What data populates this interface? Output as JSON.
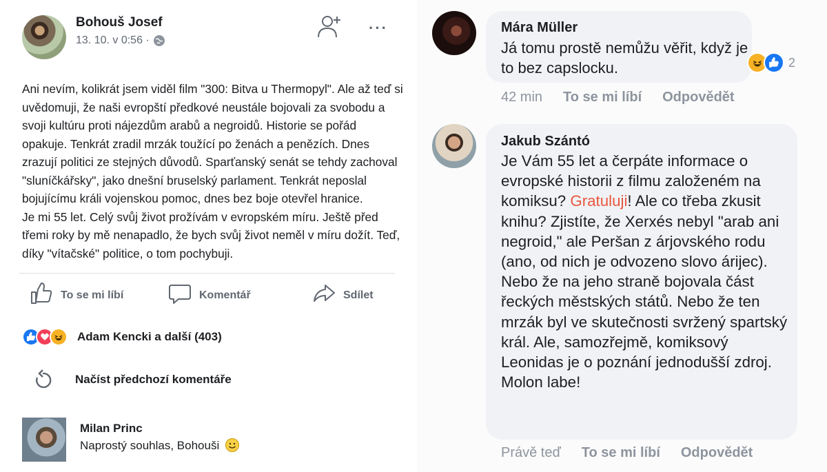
{
  "post": {
    "author": "Bohouš Josef",
    "timestamp": "13. 10. v 0:56 ·",
    "body": "Ani nevím, kolikrát jsem viděl film \"300: Bitva u Thermopyl\". Ale až teď si uvědomuji, že naši evropští předkové neustále bojovali za svobodu a svoji kultúru proti nájezdům arabů a negroidů. Historie se pořád opakuje. Tenkrát zradil mrzák toužící po ženách a penězích. Dnes zrazují politici ze stejných důvodů. Sparťanský senát se tehdy zachoval \"sluníčkářsky\", jako dnešní bruselský parlament. Tenkrát neposlal bojujícímu králi vojenskou pomoc, dnes bez boje otevřel hranice.\nJe mi 55 let. Celý svůj život prožívám v evropském míru. Ještě před třemi roky by mě nenapadlo, že bych svůj život neměl v míru dožít. Teď, díky  \"vítačské\" politice, o tom pochybuji.",
    "actions": {
      "like": "To se mi líbí",
      "comment": "Komentář",
      "share": "Sdílet"
    },
    "reactions_summary": "Adam Kencki a další (403)",
    "load_previous": "Načíst předchozí komentáře"
  },
  "comments_left": [
    {
      "author": "Milan Princ",
      "text": "Naprostý souhlas, Bohouši"
    }
  ],
  "comments_right": [
    {
      "author": "Mára Müller",
      "text": "Já tomu prostě nemůžu věřit, když je to bez capslocku.",
      "reaction_count": "2",
      "time": "42 min",
      "like": "To se mi líbí",
      "reply": "Odpovědět"
    },
    {
      "author": "Jakub Szántó",
      "text_before": "Je Vám 55 let a čerpáte informace o evropské historii z filmu založeném na komiksu? ",
      "text_highlight": "Gratuluji",
      "text_after": "! Ale co třeba zkusit knihu? Zjistíte, že Xerxés nebyl \"arab ani negroid,\" ale Peršan z árjovského rodu (ano, od nich je odvozeno slovo árijec). Nebo že na jeho straně bojovala část řeckých městských států. Nebo že ten mrzák byl ve skutečnosti svržený spartský král. Ale, samozřejmě, komiksový Leonidas je o poznání jednodušší zdroj. Molon labe!",
      "time": "Právě teď",
      "like": "To se mi líbí",
      "reply": "Odpovědět"
    }
  ],
  "colors": {
    "highlight": "#e9573f",
    "like_blue": "#1877f2",
    "love_red": "#f33e58",
    "haha_yellow": "#f7b125",
    "meta_gray": "#8d949e"
  },
  "icons": [
    "add-friend-icon",
    "more-icon",
    "globe-icon",
    "like-icon",
    "comment-icon",
    "share-icon",
    "reload-icon",
    "smiley-icon"
  ]
}
